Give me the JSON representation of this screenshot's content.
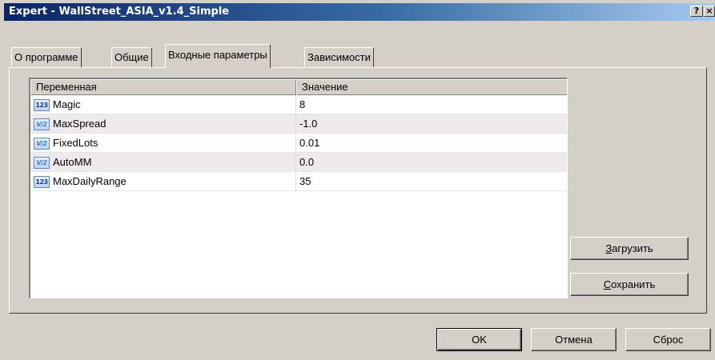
{
  "window": {
    "title": "Expert - WallStreet_ASIA_v1.4_Simple",
    "help_label": "?",
    "close_label": "×"
  },
  "tabs": [
    {
      "label": "О программе"
    },
    {
      "label": "Общие"
    },
    {
      "label": "Входные параметры",
      "active": true
    },
    {
      "label": "Зависимости"
    }
  ],
  "table": {
    "columns": [
      "Переменная",
      "Значение"
    ],
    "rows": [
      {
        "name": "Magic",
        "value": "8",
        "type": "int",
        "icon": "123"
      },
      {
        "name": "MaxSpread",
        "value": "-1.0",
        "type": "double",
        "icon": "V/2"
      },
      {
        "name": "FixedLots",
        "value": "0.01",
        "type": "double",
        "icon": "V/2"
      },
      {
        "name": "AutoMM",
        "value": "0.0",
        "type": "double",
        "icon": "V/2"
      },
      {
        "name": "MaxDailyRange",
        "value": "35",
        "type": "int",
        "icon": "123"
      }
    ]
  },
  "side_buttons": {
    "load_mnemonic": "З",
    "load_rest": "агрузить",
    "save_mnemonic": "С",
    "save_rest": "охранить"
  },
  "footer_buttons": {
    "ok_label": "OK",
    "cancel_label": "Отмена",
    "reset_label": "Сброс"
  },
  "colors": {
    "titlebar_start": "#0a246a",
    "titlebar_end": "#a6caf0",
    "face": "#d4d0c8",
    "row_alt": "#ede9ed"
  }
}
